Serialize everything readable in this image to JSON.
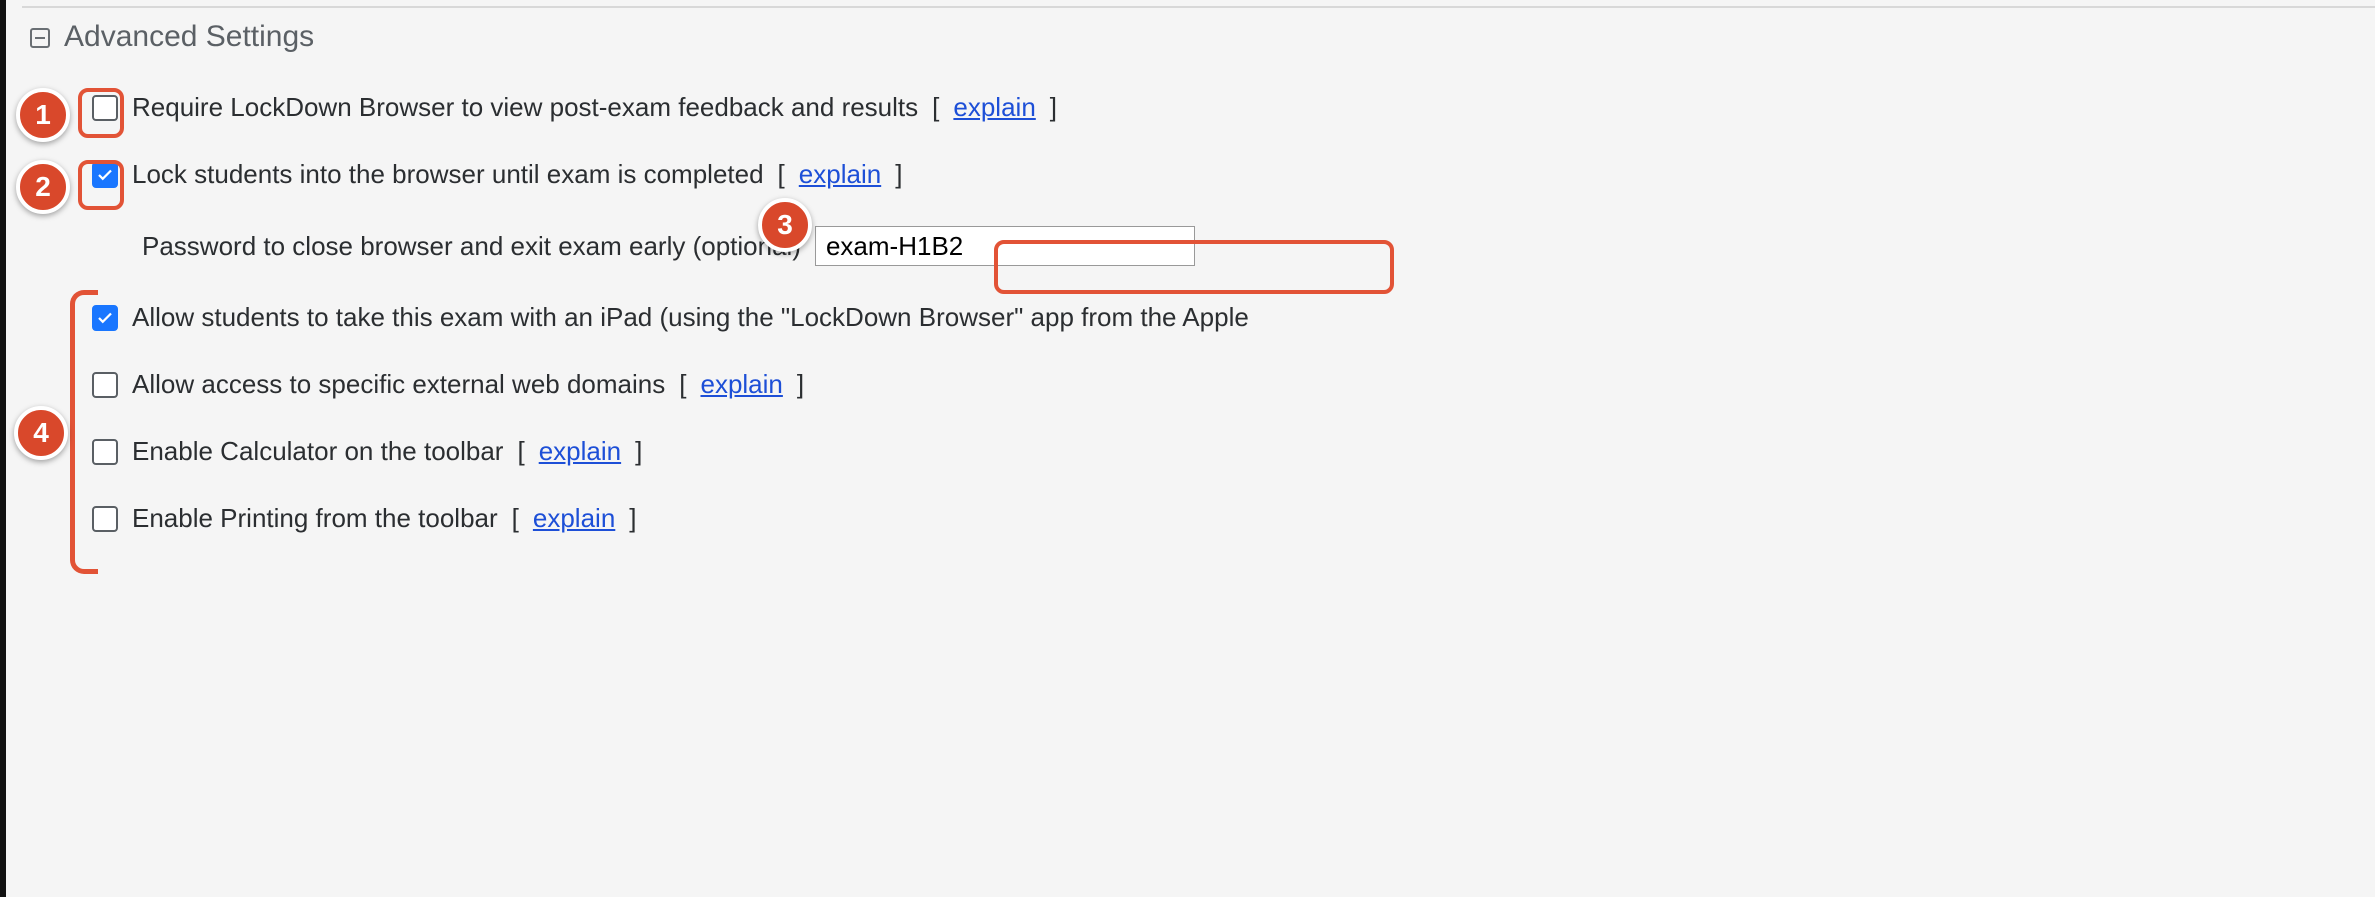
{
  "section_title": "Advanced Settings",
  "rows": {
    "r1": {
      "label": "Require LockDown Browser to view post-exam feedback and results",
      "explain": "explain",
      "checked": false
    },
    "r2": {
      "label": "Lock students into the browser until exam is completed",
      "explain": "explain",
      "checked": true
    },
    "r2_sub": {
      "label": "Password to close browser and exit exam early (optional)",
      "value": "exam-H1B2"
    },
    "r3": {
      "label": "Allow students to take this exam with an iPad (using the \"LockDown Browser\" app from the Apple",
      "checked": true
    },
    "r4": {
      "label": "Allow access to specific external web domains",
      "explain": "explain",
      "checked": false
    },
    "r5": {
      "label": "Enable Calculator on the toolbar",
      "explain": "explain",
      "checked": false
    },
    "r6": {
      "label": "Enable Printing from the toolbar",
      "explain": "explain",
      "checked": false
    }
  },
  "annotations": {
    "n1": "1",
    "n2": "2",
    "n3": "3",
    "n4": "4"
  }
}
